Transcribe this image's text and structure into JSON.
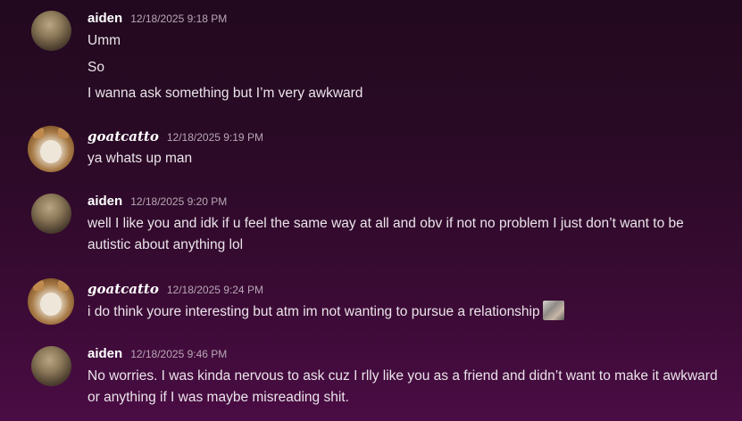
{
  "messages": [
    {
      "username": "aiden",
      "timestamp": "12/18/2025 9:18 PM",
      "lines": [
        "Umm",
        "So",
        "I wanna ask something but I’m very awkward"
      ]
    },
    {
      "username": "goatcatto",
      "timestamp": "12/18/2025 9:19 PM",
      "lines": [
        "ya whats up man"
      ]
    },
    {
      "username": "aiden",
      "timestamp": "12/18/2025 9:20 PM",
      "lines": [
        "well I like you and idk if u feel the same way at all and obv if not no problem I just don’t want to be autistic about anything lol"
      ]
    },
    {
      "username": "goatcatto",
      "timestamp": "12/18/2025 9:24 PM",
      "lines": [
        "i do think youre interesting but atm im not wanting to pursue a relationship"
      ]
    },
    {
      "username": "aiden",
      "timestamp": "12/18/2025 9:46 PM",
      "lines": [
        "No worries. I was kinda nervous to ask cuz I rlly like you as a friend and didn’t want to make it awkward or anything if I was maybe misreading shit."
      ]
    }
  ]
}
